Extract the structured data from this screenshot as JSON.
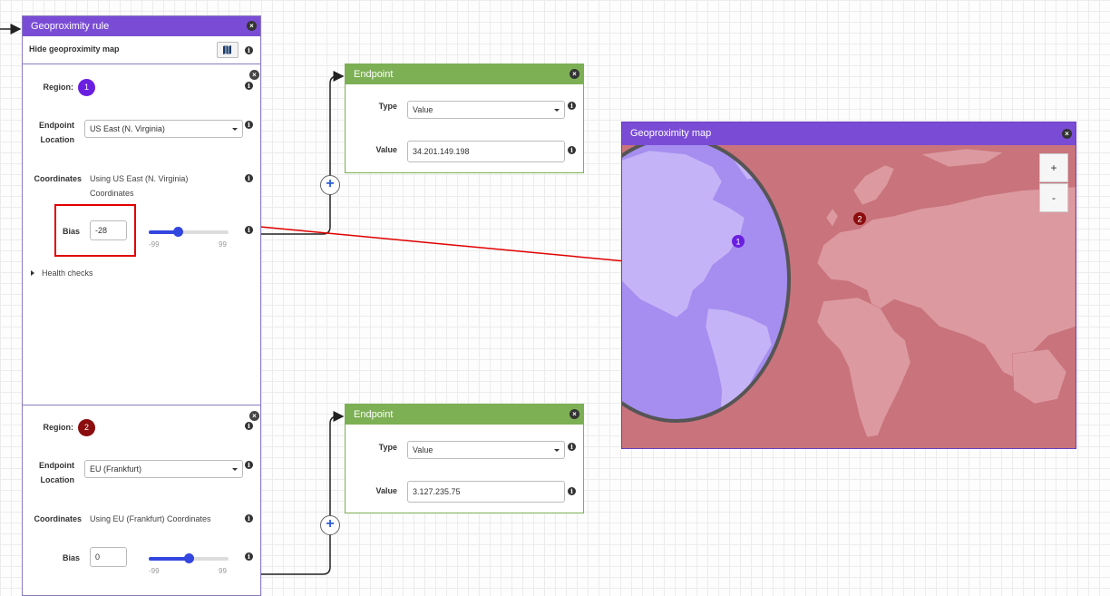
{
  "rule": {
    "title": "Geoproximity rule",
    "hide_map_label": "Hide geoproximity map"
  },
  "regions": [
    {
      "region_label": "Region:",
      "region_number": "1",
      "endpoint_location_label_1": "Endpoint",
      "endpoint_location_label_2": "Location",
      "endpoint_location_value": "US East (N. Virginia)",
      "coordinates_label": "Coordinates",
      "coordinates_value_1": "Using US East (N. Virginia)",
      "coordinates_value_2": "Coordinates",
      "bias_label": "Bias",
      "bias_value": "-28",
      "bias_min": "-99",
      "bias_max": "99",
      "bias_fraction": 0.359,
      "health_checks_label": "Health checks",
      "color": "#6a1fe0"
    },
    {
      "region_label": "Region:",
      "region_number": "2",
      "endpoint_location_label_1": "Endpoint",
      "endpoint_location_label_2": "Location",
      "endpoint_location_value": "EU (Frankfurt)",
      "coordinates_label": "Coordinates",
      "coordinates_value_1": "Using EU (Frankfurt) Coordinates",
      "bias_label": "Bias",
      "bias_value": "0",
      "bias_min": "-99",
      "bias_max": "99",
      "bias_fraction": 0.5,
      "color": "#8b0d0d"
    }
  ],
  "endpoints": [
    {
      "title": "Endpoint",
      "type_label": "Type",
      "type_value": "Value",
      "value_label": "Value",
      "value": "34.201.149.198"
    },
    {
      "title": "Endpoint",
      "type_label": "Type",
      "type_value": "Value",
      "value_label": "Value",
      "value": "3.127.235.75"
    }
  ],
  "map": {
    "title": "Geoproximity map",
    "zoom_in": "+",
    "zoom_out": "-",
    "marker_1": "1",
    "marker_2": "2",
    "region_1_color": "#a58ef0",
    "region_2_color": "#c9737c",
    "header_color": "#7a4cd6"
  },
  "icons": {
    "close": "close-icon",
    "info": "info-icon",
    "map": "map-icon",
    "caret": "chevron-down-icon",
    "expand": "caret-right-icon",
    "add": "plus-icon"
  },
  "colors": {
    "purple_header": "#7a4cd6",
    "green_header": "#7db055",
    "slider": "#3346e0",
    "highlight": "#e00000"
  }
}
